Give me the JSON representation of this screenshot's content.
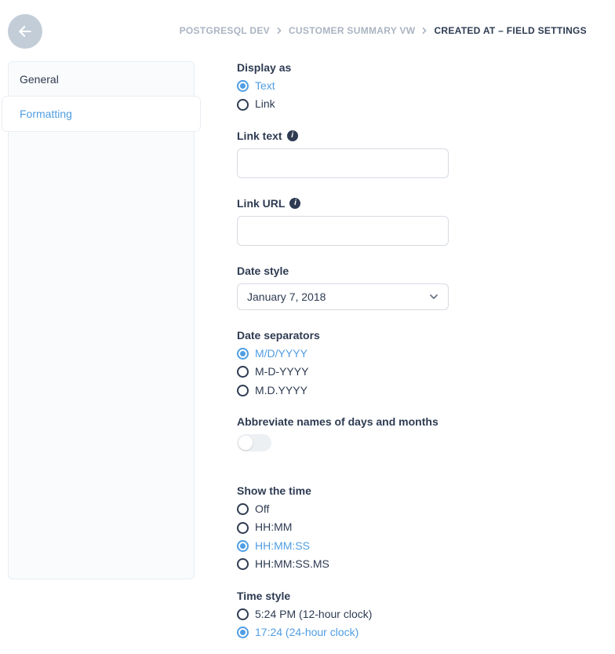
{
  "breadcrumb": {
    "items": [
      {
        "label": "POSTGRESQL DEV"
      },
      {
        "label": "CUSTOMER SUMMARY VW"
      }
    ],
    "current": "CREATED AT – FIELD SETTINGS"
  },
  "sidebar": {
    "items": [
      {
        "label": "General",
        "active": false
      },
      {
        "label": "Formatting",
        "active": true
      }
    ]
  },
  "form": {
    "displayAs": {
      "label": "Display as",
      "options": [
        "Text",
        "Link"
      ],
      "selected": "Text"
    },
    "linkText": {
      "label": "Link text",
      "value": ""
    },
    "linkUrl": {
      "label": "Link URL",
      "value": ""
    },
    "dateStyle": {
      "label": "Date style",
      "value": "January 7, 2018"
    },
    "dateSeparators": {
      "label": "Date separators",
      "options": [
        "M/D/YYYY",
        "M-D-YYYY",
        "M.D.YYYY"
      ],
      "selected": "M/D/YYYY"
    },
    "abbreviate": {
      "label": "Abbreviate names of days and months",
      "value": false
    },
    "showTime": {
      "label": "Show the time",
      "options": [
        "Off",
        "HH:MM",
        "HH:MM:SS",
        "HH:MM:SS.MS"
      ],
      "selected": "HH:MM:SS"
    },
    "timeStyle": {
      "label": "Time style",
      "options": [
        "5:24 PM (12-hour clock)",
        "17:24 (24-hour clock)"
      ],
      "selected": "17:24 (24-hour clock)"
    }
  }
}
